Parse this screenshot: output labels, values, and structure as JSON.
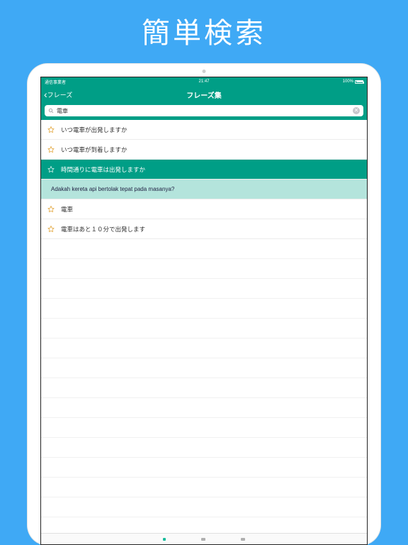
{
  "promo": {
    "title": "簡単検索"
  },
  "statusbar": {
    "carrier": "通信事業者",
    "time": "21:47",
    "battery": "100%"
  },
  "navbar": {
    "back_label": "フレーズ",
    "title": "フレーズ集"
  },
  "search": {
    "query": "電車"
  },
  "rows": [
    {
      "text": "いつ電車が出発しますか",
      "kind": "normal"
    },
    {
      "text": "いつ電車が到着しますか",
      "kind": "normal"
    },
    {
      "text": "時間通りに電車は出発しますか",
      "kind": "selected"
    },
    {
      "text": "Adakah kereta api bertolak tepat pada masanya?",
      "kind": "translation"
    },
    {
      "text": "電車",
      "kind": "normal"
    },
    {
      "text": "電車はあと１０分で出発します",
      "kind": "normal"
    }
  ]
}
